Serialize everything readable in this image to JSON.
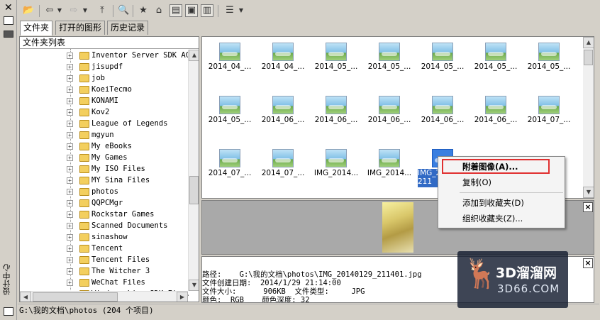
{
  "strip": {
    "close": "✕",
    "vertical_title": "设计中心"
  },
  "tabs": [
    {
      "label": "文件夹"
    },
    {
      "label": "打开的图形"
    },
    {
      "label": "历史记录"
    }
  ],
  "tree": {
    "header": "文件夹列表",
    "items": [
      {
        "label": "Inventor Server SDK ACA"
      },
      {
        "label": "jisupdf"
      },
      {
        "label": "job"
      },
      {
        "label": "KoeiTecmo"
      },
      {
        "label": "KONAMI"
      },
      {
        "label": "Kov2"
      },
      {
        "label": "League of Legends"
      },
      {
        "label": "mgyun"
      },
      {
        "label": "My eBooks"
      },
      {
        "label": "My Games"
      },
      {
        "label": "My ISO Files"
      },
      {
        "label": "MY Sina Files"
      },
      {
        "label": "photos"
      },
      {
        "label": "QQPCMgr"
      },
      {
        "label": "Rockstar Games"
      },
      {
        "label": "Scanned Documents"
      },
      {
        "label": "sinashow"
      },
      {
        "label": "Tencent"
      },
      {
        "label": "Tencent Files"
      },
      {
        "label": "The Witcher 3"
      },
      {
        "label": "WeChat Files"
      },
      {
        "label": "Windows Live SDK Fi..."
      }
    ]
  },
  "thumbnails": [
    {
      "caption": "2014_04_..."
    },
    {
      "caption": "2014_04_..."
    },
    {
      "caption": "2014_05_..."
    },
    {
      "caption": "2014_05_..."
    },
    {
      "caption": "2014_05_..."
    },
    {
      "caption": "2014_05_..."
    },
    {
      "caption": "2014_05_..."
    },
    {
      "caption": "2014_05_..."
    },
    {
      "caption": "2014_06_..."
    },
    {
      "caption": "2014_06_..."
    },
    {
      "caption": "2014_06_..."
    },
    {
      "caption": "2014_06_..."
    },
    {
      "caption": "2014_06_..."
    },
    {
      "caption": "2014_07_..."
    },
    {
      "caption": "2014_07_..."
    },
    {
      "caption": "2014_07_..."
    },
    {
      "caption": "IMG_2014..."
    },
    {
      "caption": "IMG_2014..."
    },
    {
      "caption": "IMG_2014 9_211",
      "selected": true
    }
  ],
  "context_menu": {
    "items": [
      {
        "label": "附着图像(A)..."
      },
      {
        "label": "复制(O)"
      },
      {
        "label": "添加到收藏夹(D)"
      },
      {
        "label": "组织收藏夹(Z)..."
      }
    ],
    "highlight_color": "#e03030"
  },
  "details": {
    "path_label": "路径:",
    "path_value": "G:\\我的文档\\photos\\IMG_20140129_211401.jpg",
    "created_label": "文件创建日期:",
    "created_value": "2014/1/29 21:14:00",
    "size_label": "文件大小:",
    "size_value": "906KB",
    "type_label": "文件类型:",
    "type_value": "JPG",
    "color_label": "颜色:",
    "color_value": "RGB",
    "depth_label": "颜色深度:",
    "depth_value": "32"
  },
  "status": {
    "text": "G:\\我的文档\\photos (204 个项目)"
  },
  "watermark": {
    "brand": "3D溜溜网",
    "domain": "3D66.COM"
  },
  "colors": {
    "selection": "#316ac5",
    "accent_red": "#e03030"
  }
}
